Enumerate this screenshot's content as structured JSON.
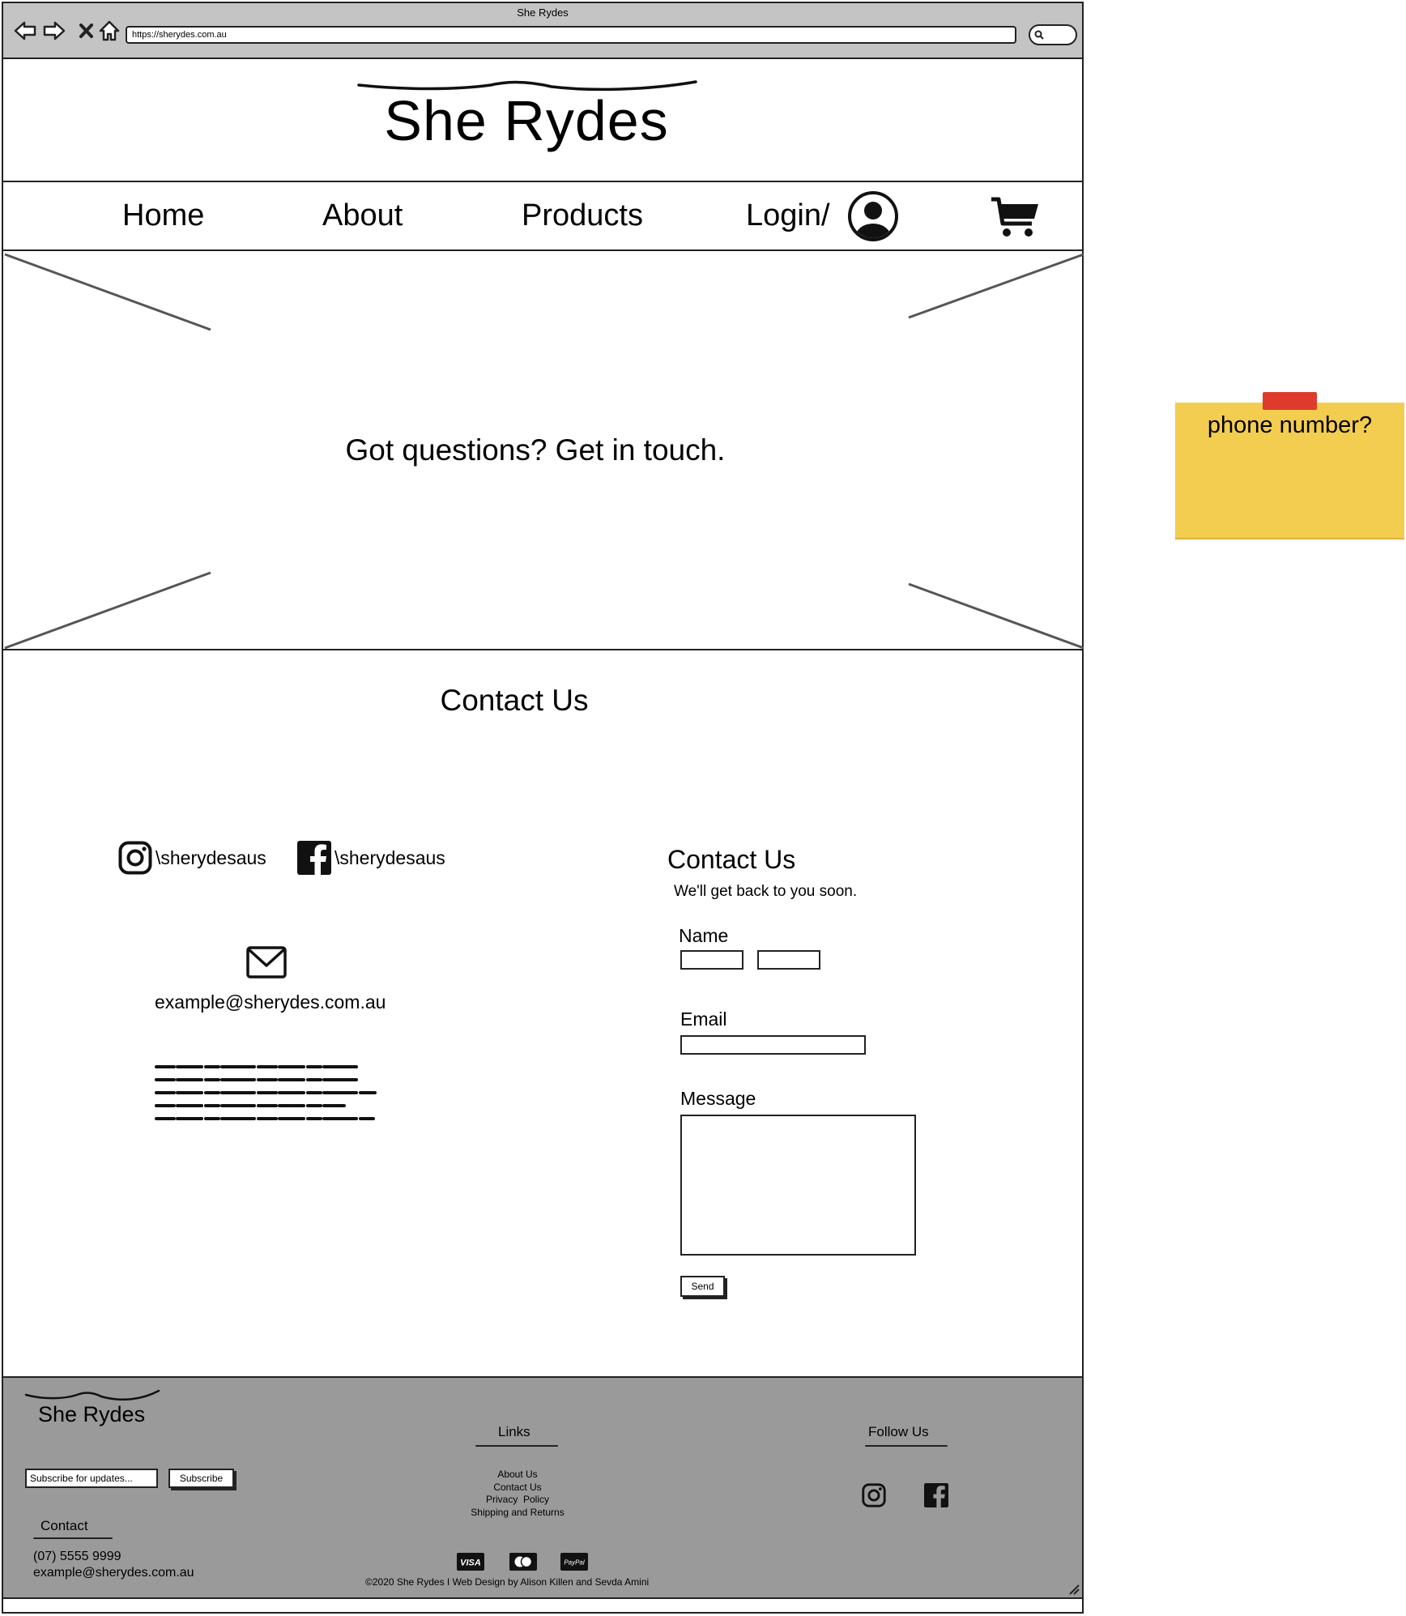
{
  "browser": {
    "title": "She Rydes",
    "url": "https://sherydes.com.au"
  },
  "header": {
    "logo": "She Rydes"
  },
  "nav": {
    "items": [
      "Home",
      "About",
      "Products"
    ],
    "login": "Login/"
  },
  "hero": {
    "text": "Got questions? Get in touch."
  },
  "contact": {
    "title": "Contact Us",
    "instagram_handle": "\\sherydesaus",
    "facebook_handle": "\\sherydesaus",
    "email": "example@sherydes.com.au"
  },
  "form": {
    "title": "Contact Us",
    "subtitle": "We'll get back to you soon.",
    "name_label": "Name",
    "email_label": "Email",
    "message_label": "Message",
    "send_label": "Send"
  },
  "footer": {
    "logo": "She Rydes",
    "subscribe_placeholder": "Subscribe for updates...",
    "subscribe_button": "Subscribe",
    "contact_heading": "Contact",
    "phone": "(07) 5555 9999",
    "email": "example@sherydes.com.au",
    "links_heading": "Links",
    "links": [
      "About Us",
      "Contact Us",
      "Privacy  Policy",
      "Shipping and Returns"
    ],
    "follow_heading": "Follow Us",
    "payments": [
      "VISA",
      "PayPal"
    ],
    "copyright": "©2020 She Rydes I Web Design by Alison Killen and Sevda Amini"
  },
  "sticky_note": {
    "text": "phone number?"
  }
}
